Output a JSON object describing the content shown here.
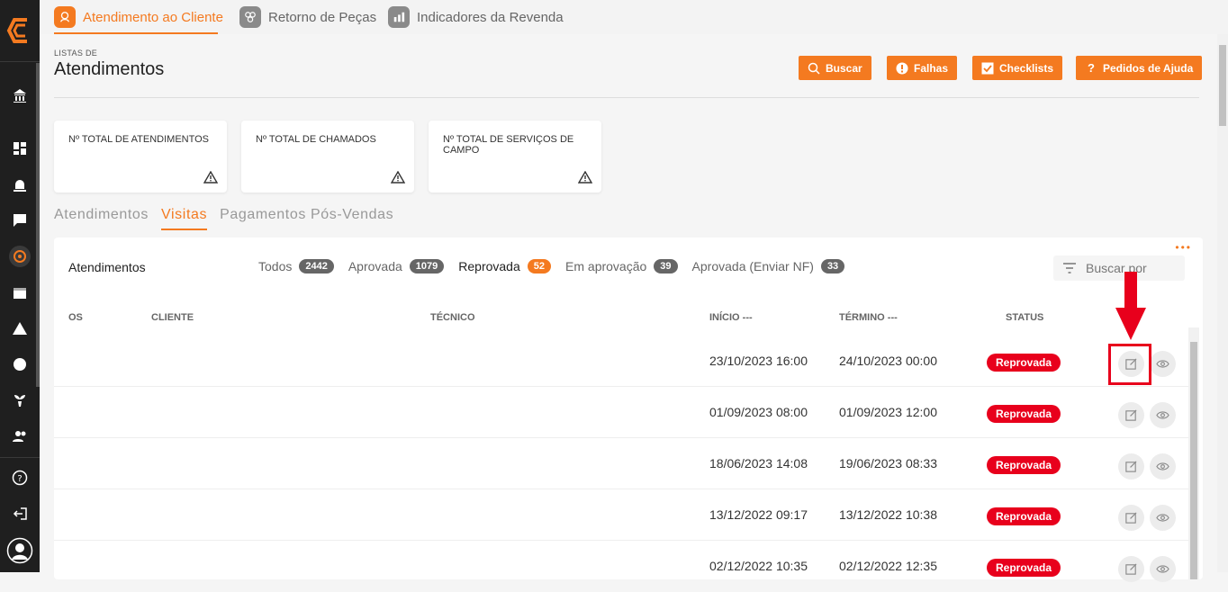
{
  "topnav": {
    "tabs": [
      {
        "label": "Atendimento ao Cliente",
        "icon": "customer-service-icon",
        "active": true
      },
      {
        "label": "Retorno de Peças",
        "icon": "parts-return-icon",
        "active": false
      },
      {
        "label": "Indicadores da Revenda",
        "icon": "indicators-icon",
        "active": false
      }
    ]
  },
  "header": {
    "subtitle": "LISTAS DE",
    "title": "Atendimentos",
    "buttons": [
      {
        "label": "Buscar",
        "icon": "search-icon"
      },
      {
        "label": "Falhas",
        "icon": "alert-icon"
      },
      {
        "label": "Checklists",
        "icon": "checkbox-icon"
      },
      {
        "label": "Pedidos de Ajuda",
        "icon": "help-icon"
      }
    ]
  },
  "cards": [
    {
      "label": "Nº total de atendimentos"
    },
    {
      "label": "Nº total de chamados"
    },
    {
      "label": "Nº total de serviços de campo"
    }
  ],
  "subtabs": [
    "Atendimentos",
    "Visitas",
    "Pagamentos Pós-Vendas"
  ],
  "panel": {
    "title": "Atendimentos",
    "filters": [
      {
        "label": "Todos",
        "count": "2442"
      },
      {
        "label": "Aprovada",
        "count": "1079"
      },
      {
        "label": "Reprovada",
        "count": "52"
      },
      {
        "label": "Em aprovação",
        "count": "39"
      },
      {
        "label": "Aprovada (Enviar NF)",
        "count": "33"
      }
    ],
    "search_placeholder": "Buscar por",
    "columns": {
      "os": "OS",
      "cliente": "CLIENTE",
      "tecnico": "TÉCNICO",
      "inicio": "INÍCIO ---",
      "termino": "TÉRMINO ---",
      "status": "STATUS"
    },
    "rows": [
      {
        "inicio": "23/10/2023 16:00",
        "termino": "24/10/2023 00:00",
        "status": "Reprovada"
      },
      {
        "inicio": "01/09/2023 08:00",
        "termino": "01/09/2023 12:00",
        "status": "Reprovada"
      },
      {
        "inicio": "18/06/2023 14:08",
        "termino": "19/06/2023 08:33",
        "status": "Reprovada"
      },
      {
        "inicio": "13/12/2022 09:17",
        "termino": "13/12/2022 10:38",
        "status": "Reprovada"
      },
      {
        "inicio": "02/12/2022 10:35",
        "termino": "02/12/2022 12:35",
        "status": "Reprovada"
      }
    ]
  },
  "colors": {
    "accent": "#f47a20",
    "danger": "#e8001c",
    "sidebar": "#1f1f1f"
  }
}
